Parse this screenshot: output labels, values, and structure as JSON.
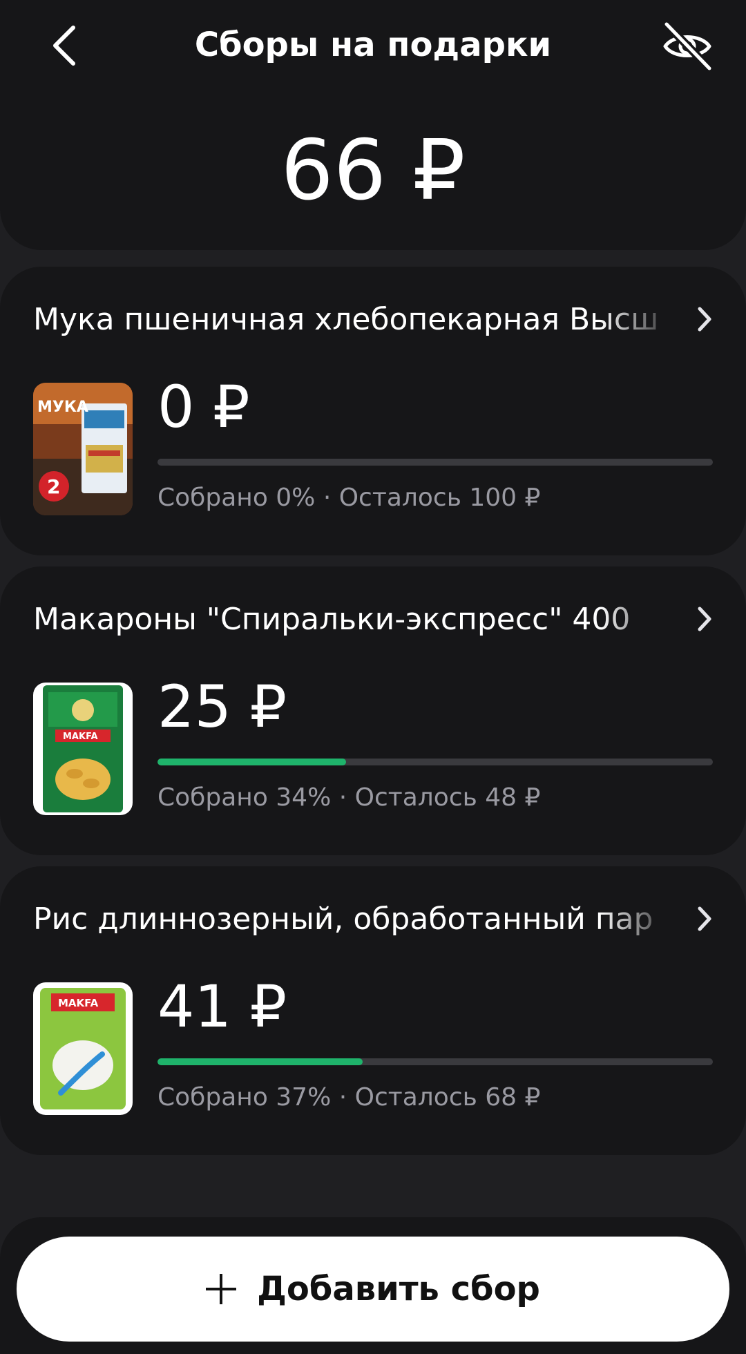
{
  "header": {
    "title": "Сборы на подарки",
    "total": "66 ₽",
    "back_icon": "chevron-left-icon",
    "visibility_icon": "eye-off-icon"
  },
  "goals": [
    {
      "title": "Мука пшеничная хлебопекарная Высш",
      "amount": "0 ₽",
      "progress": 0,
      "meta": "Собрано 0% · Осталось 100 ₽",
      "thumb_label": "МУКА"
    },
    {
      "title": "Макароны \"Спиральки-экспресс\" 400",
      "amount": "25 ₽",
      "progress": 0.34,
      "meta": "Собрано 34% · Осталось 48 ₽",
      "thumb_label": "MAKFA"
    },
    {
      "title": "Рис длиннозерный, обработанный пар",
      "amount": "41 ₽",
      "progress": 0.37,
      "meta": "Собрано 37% · Осталось 68 ₽",
      "thumb_label": "MAKFA"
    }
  ],
  "footer": {
    "add_label": "Добавить сбор",
    "add_icon": "plus-icon"
  },
  "colors": {
    "background": "#1f1f22",
    "card": "#161618",
    "progress": "#1fb36b",
    "track": "#3a3a3e",
    "muted_text": "#9a9aa2"
  }
}
